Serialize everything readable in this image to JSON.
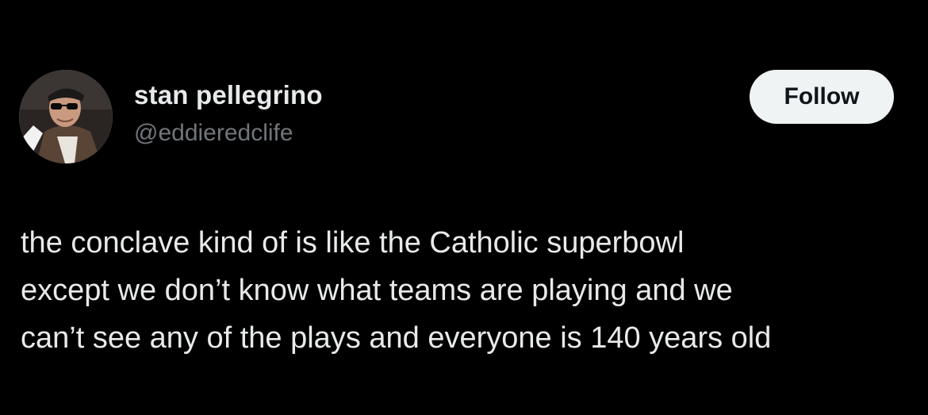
{
  "post": {
    "author": {
      "display_name": "stan pellegrino",
      "handle": "@eddieredclife",
      "avatar_icon": "profile-photo-avatar"
    },
    "follow_label": "Follow",
    "text_lines": [
      "the conclave kind of is like the Catholic superbowl",
      "except we don’t know what teams are playing and we",
      "can’t see any of the plays and everyone is 140 years old"
    ]
  },
  "colors": {
    "background": "#000000",
    "primary_text": "#e7e9ea",
    "secondary_text": "#71767b",
    "button_bg": "#eff3f4",
    "button_text": "#0f1419"
  }
}
